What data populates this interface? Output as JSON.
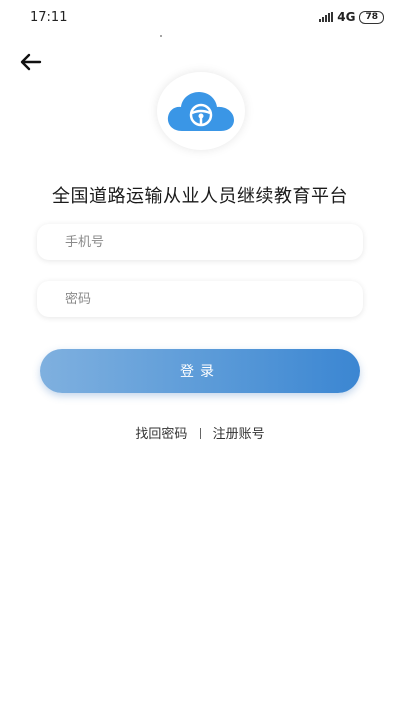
{
  "status_bar": {
    "time": "17:11",
    "network": "4G",
    "network_sub": "ull",
    "battery": "78"
  },
  "header": {
    "back_icon": "arrow-left-icon"
  },
  "logo": {
    "icon": "cloud-steering-wheel-icon",
    "color": "#3a96e6"
  },
  "app_title": "全国道路运输从业人员继续教育平台",
  "form": {
    "phone_placeholder": "手机号",
    "phone_value": "",
    "password_placeholder": "密码",
    "password_value": "",
    "login_label": "登录"
  },
  "links": {
    "forgot_password": "找回密码",
    "separator": "|",
    "register": "注册账号"
  },
  "colors": {
    "button_gradient_start": "#7fb0df",
    "button_gradient_end": "#3b86d2"
  }
}
